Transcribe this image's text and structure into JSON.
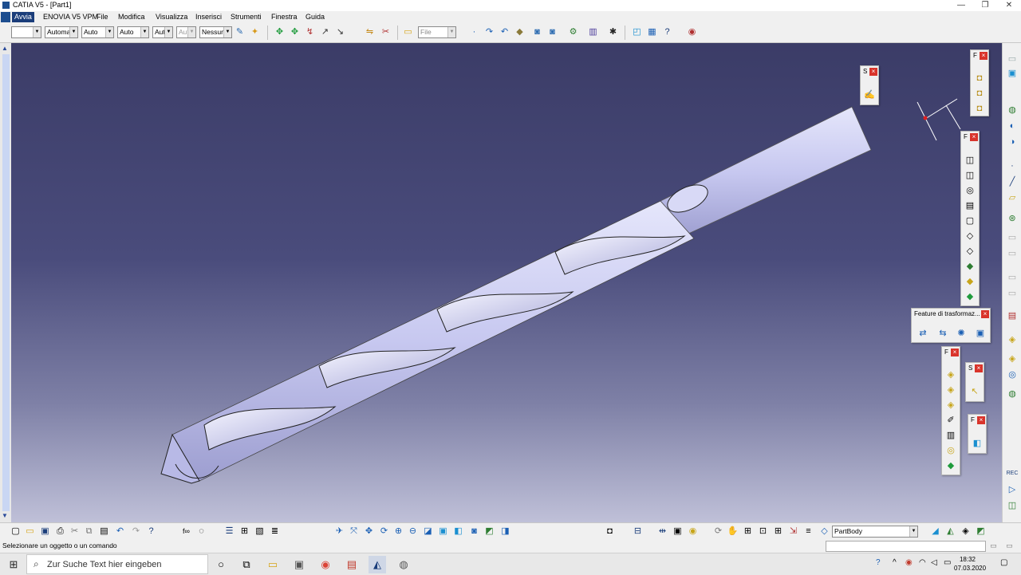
{
  "window": {
    "title": "CATIA V5 - [Part1]",
    "controls": [
      "—",
      "❐",
      "✕"
    ]
  },
  "menu": {
    "items": [
      "Avvia",
      "ENOVIA V5 VPM",
      "File",
      "Modifica",
      "Visualizza",
      "Inserisci",
      "Strumenti",
      "Finestra",
      "Guida"
    ]
  },
  "toolbar": {
    "combos": [
      "",
      "Automa",
      "Auto",
      "Auto",
      "Aut",
      "Aut",
      "Nessun",
      "File"
    ]
  },
  "floating": {
    "sketch_tb_title": "S",
    "sketch_tb2_title": "S",
    "features_tb_title": "F",
    "features2_tb_title": "F",
    "features3_tb_title": "F",
    "features4_tb_title": "F",
    "features5_tb_title": "F",
    "transform_tb_title": "Feature di trasformaz...",
    "close": "×"
  },
  "bottom_toolbar": {
    "body_select": "PartBody"
  },
  "status": {
    "message": "Selezionare un oggetto o un comando"
  },
  "taskbar": {
    "search_placeholder": "Zur Suche Text hier eingeben",
    "time": "18:32",
    "date": "07.03.2020"
  },
  "colors": {
    "accent": "#1a3d7a",
    "close_red": "#d9342b",
    "drill_body": "#c7c8f0",
    "viewport_top": "#3b3c67",
    "viewport_bottom": "#bfc0d8"
  }
}
